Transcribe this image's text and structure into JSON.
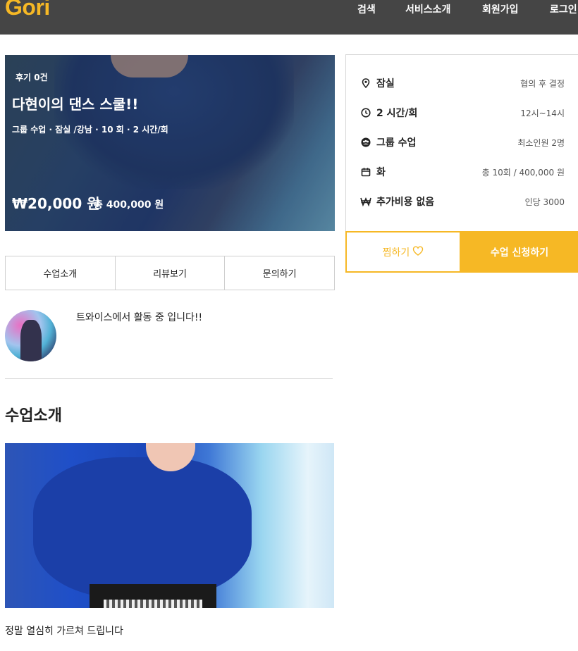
{
  "header": {
    "logo": "Gori",
    "nav": [
      "검색",
      "서비스소개",
      "회원가입",
      "로그인"
    ]
  },
  "hero": {
    "reviews": "후기 0건",
    "title": "다현이의 댄스 스쿨!!",
    "meta": "그룹 수업 · 잠실 /강남 · 10 회 · 2 시간/회",
    "price": "₩20,000 원",
    "total": "총 400,000 원"
  },
  "info": {
    "rows": [
      {
        "icon": "location-pin-icon",
        "label": "잠실",
        "value": "협의 후 결정"
      },
      {
        "icon": "clock-icon",
        "label": "2 시간/회",
        "value": "12시~14시"
      },
      {
        "icon": "group-icon",
        "label": "그룹 수업",
        "value": "최소인원 2명"
      },
      {
        "icon": "calendar-icon",
        "label": "화",
        "value": "총 10회 / 400,000 원"
      },
      {
        "icon": "won-icon",
        "label": "추가비용 없음",
        "value": "인당 3000"
      }
    ],
    "like_label": "찜하기",
    "apply_label": "수업 신청하기"
  },
  "tabs": [
    "수업소개",
    "리뷰보기",
    "문의하기"
  ],
  "profile": {
    "intro": "트와이스에서 활동 중 입니다!!"
  },
  "section": {
    "title": "수업소개",
    "caption": "정말 열심히 가르쳐 드립니다"
  },
  "colors": {
    "accent": "#f6b825",
    "header_bg": "#454545"
  }
}
